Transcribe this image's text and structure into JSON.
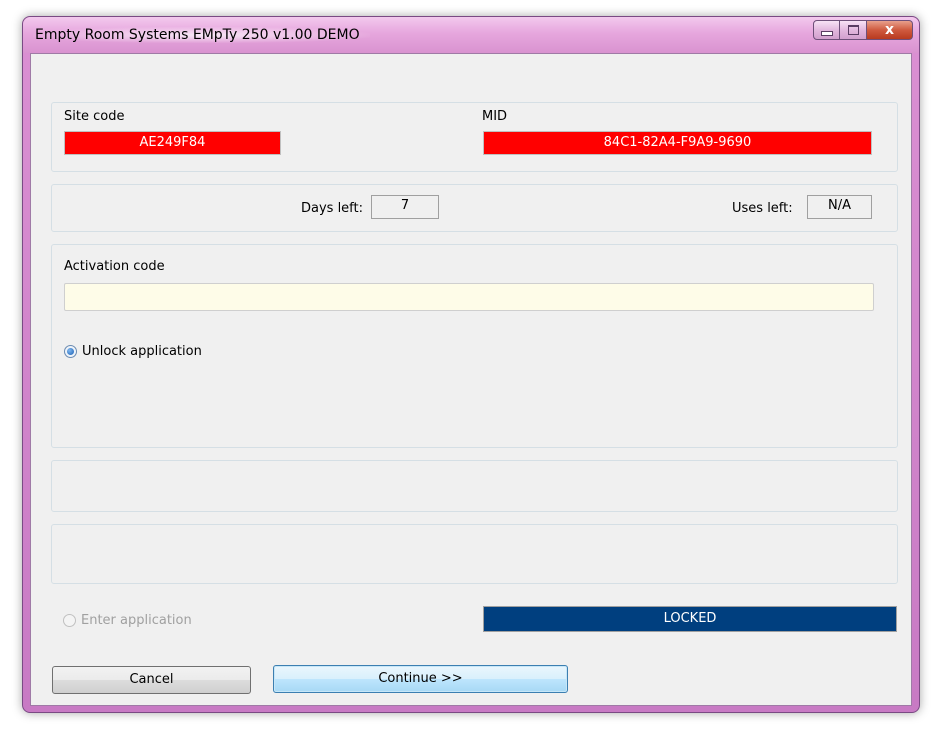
{
  "window": {
    "title": "Empty Room Systems EMpTy 250 v1.00 DEMO",
    "controls": {
      "minimize": "minimize-icon",
      "maximize": "maximize-icon",
      "close_label": "x"
    }
  },
  "site": {
    "site_code_label": "Site code",
    "site_code_value": "AE249F84",
    "mid_label": "MID",
    "mid_value": "84C1-82A4-F9A9-9690"
  },
  "usage": {
    "days_left_label": "Days left:",
    "days_left_value": "7",
    "uses_left_label": "Uses left:",
    "uses_left_value": "N/A"
  },
  "activation": {
    "label": "Activation code",
    "value": "",
    "placeholder": "",
    "unlock_option": "Unlock application"
  },
  "enter_option": "Enter application",
  "status": "LOCKED",
  "buttons": {
    "cancel": "Cancel",
    "continue": "Continue >>"
  },
  "colors": {
    "field_red": "#ff0000",
    "status_blue": "#003f7f",
    "input_bg": "#fefce8"
  }
}
